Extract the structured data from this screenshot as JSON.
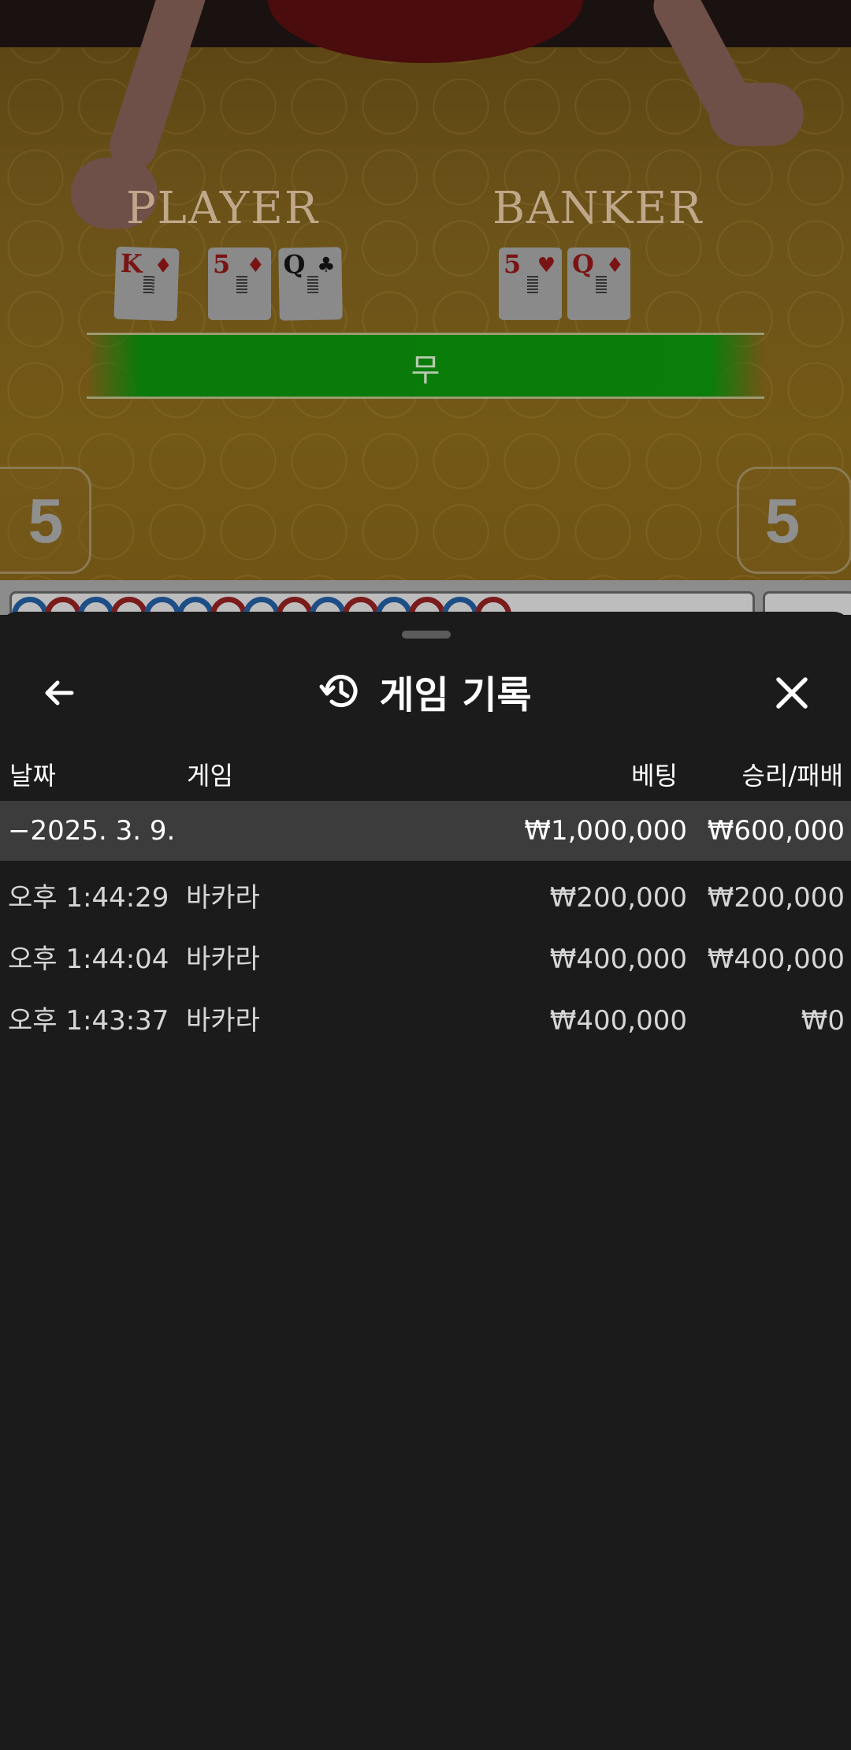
{
  "game_scene": {
    "player_label": "PLAYER",
    "banker_label": "BANKER",
    "player_cards": [
      {
        "rank": "K",
        "suit": "♦",
        "color": "red"
      },
      {
        "rank": "5",
        "suit": "♦",
        "color": "red"
      },
      {
        "rank": "Q",
        "suit": "♣",
        "color": "black"
      }
    ],
    "banker_cards": [
      {
        "rank": "5",
        "suit": "♥",
        "color": "red"
      },
      {
        "rank": "Q",
        "suit": "♦",
        "color": "red"
      }
    ],
    "result_label": "무",
    "player_score": "5",
    "banker_score": "5"
  },
  "sheet": {
    "title": "게임 기록",
    "icons": {
      "back": "back-arrow-icon",
      "history": "history-icon",
      "close": "close-icon"
    },
    "columns": {
      "date": "날짜",
      "game": "게임",
      "bet": "베팅",
      "win_loss": "승리/패배"
    },
    "group": {
      "date": "−2025. 3. 9.",
      "bet_total": "₩1,000,000",
      "win_loss_total": "₩600,000"
    },
    "rows": [
      {
        "time": "오후 1:44:29",
        "game": "바카라",
        "bet": "₩200,000",
        "win_loss": "₩200,000"
      },
      {
        "time": "오후 1:44:04",
        "game": "바카라",
        "bet": "₩400,000",
        "win_loss": "₩400,000"
      },
      {
        "time": "오후 1:43:37",
        "game": "바카라",
        "bet": "₩400,000",
        "win_loss": "₩0"
      }
    ]
  },
  "colors": {
    "sheet_bg": "#1b1b1b",
    "group_row_bg": "#3c3c3c",
    "result_green": "#0a7a0a",
    "text_primary": "#ffffff"
  }
}
